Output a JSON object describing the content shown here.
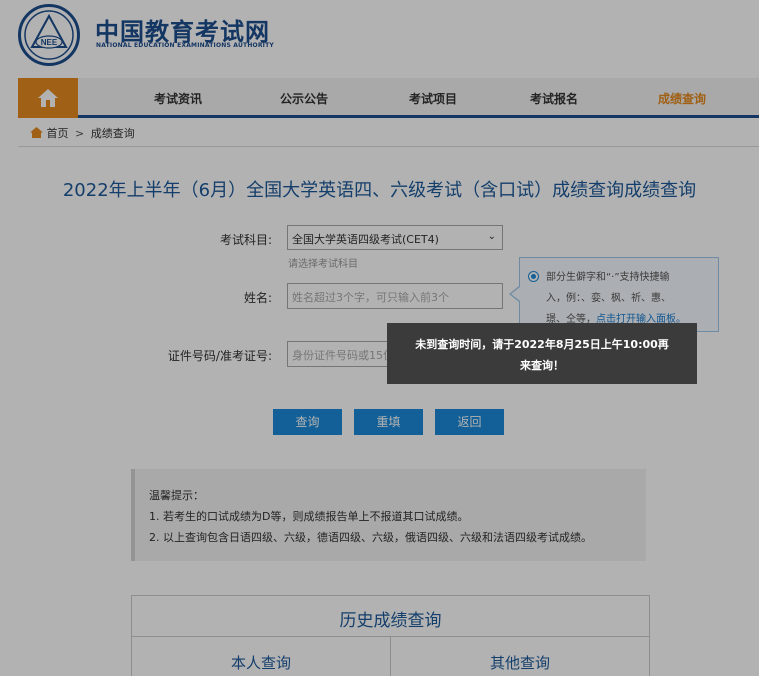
{
  "header": {
    "logo_badge": "NEE",
    "logo_cn": "中国教育考试网",
    "logo_en": "NATIONAL EDUCATION EXAMINATIONS AUTHORITY"
  },
  "nav": {
    "home_icon": "home-icon",
    "items": [
      {
        "label": "考试资讯"
      },
      {
        "label": "公示公告"
      },
      {
        "label": "考试项目"
      },
      {
        "label": "考试报名"
      },
      {
        "label": "成绩查询"
      }
    ],
    "active_color": "#e58a1f",
    "accent_color": "#1d4e8f"
  },
  "breadcrumb": {
    "home": "首页",
    "separator": ">",
    "current": "成绩查询"
  },
  "page_title": "2022年上半年（6月）全国大学英语四、六级考试（含口试）成绩查询成绩查询",
  "form": {
    "subject_label": "考试科目:",
    "subject_value": "全国大学英语四级考试(CET4)",
    "subject_hint": "请选择考试科目",
    "name_label": "姓名:",
    "name_placeholder": "姓名超过3个字，可只输入前3个",
    "id_label": "证件号码/准考证号:",
    "id_placeholder": "身份证件号码或15位笔试、口试准考证号"
  },
  "tip": {
    "line1": "部分生僻字和“·”支持快捷输",
    "line2": "入，例：、娈、枫、祈、惠、",
    "line3_text": "璟、仝等，",
    "line3_link": "点击打开输入面板。"
  },
  "buttons": {
    "query": "查询",
    "reset": "重填",
    "back": "返回",
    "color": "#1a8ad8"
  },
  "notice": {
    "title": "温馨提示：",
    "item1": "1. 若考生的口试成绩为D等，则成绩报告单上不报道其口试成绩。",
    "item2": "2. 以上查询包含日语四级、六级，德语四级、六级，俄语四级、六级和法语四级考试成绩。"
  },
  "history": {
    "title": "历史成绩查询",
    "tab_self": "本人查询",
    "tab_other": "其他查询"
  },
  "toast": {
    "line1": "未到查询时间，请于2022年8月25日上午10:00再",
    "line2": "来查询！"
  }
}
